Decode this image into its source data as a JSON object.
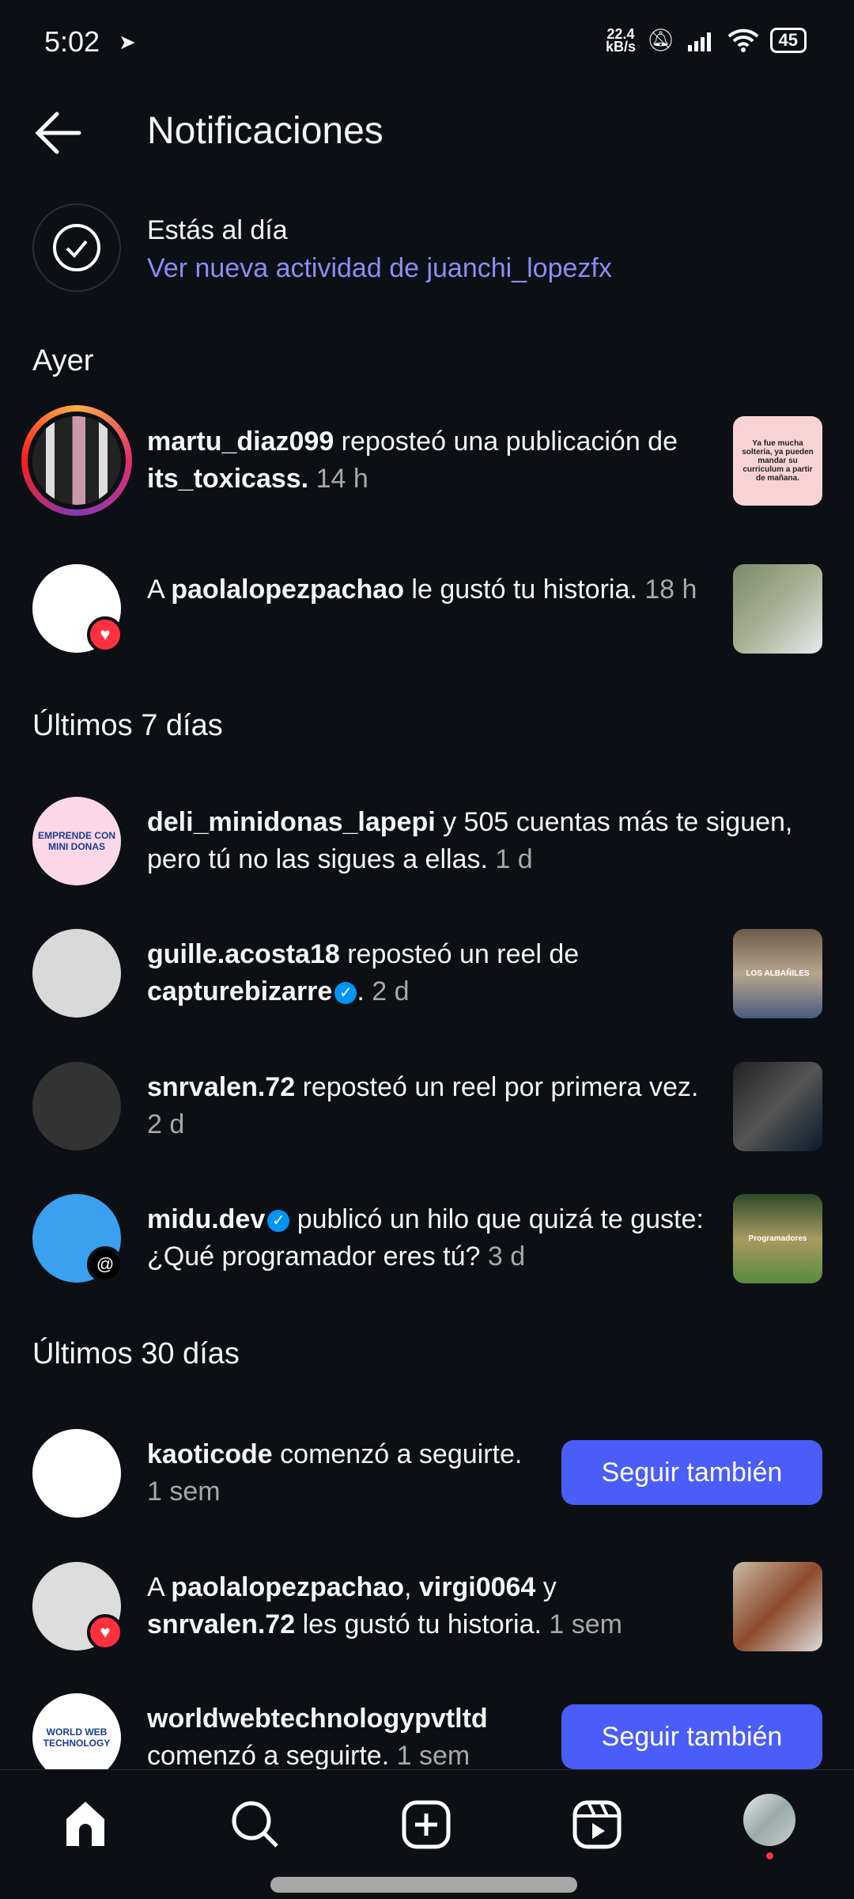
{
  "status_bar": {
    "time": "5:02",
    "net_speed": "22.4",
    "net_unit": "kB/s",
    "battery": "45"
  },
  "header": {
    "title": "Notificaciones"
  },
  "up_to_date": {
    "title": "Estás al día",
    "link": "Ver nueva actividad de juanchi_lopezfx"
  },
  "sections": [
    "Ayer",
    "Últimos 7 días",
    "Últimos 30 días"
  ],
  "notifications": [
    {
      "segments": [
        {
          "t": "martu_diaz099",
          "b": true
        },
        {
          "t": " reposteó una publicación de "
        },
        {
          "t": "its_toxicass.",
          "b": true
        },
        {
          "t": " 14 h",
          "m": true
        }
      ],
      "thumb": "Ya fue mucha soltería, ya pueden mandar su curriculum a partir de mañana.",
      "story_ring": true
    },
    {
      "segments": [
        {
          "t": "A "
        },
        {
          "t": "paolalopezpachao",
          "b": true
        },
        {
          "t": " le gustó tu historia."
        },
        {
          "t": " 18 h",
          "m": true
        }
      ],
      "badge": "heart-icon"
    },
    {
      "segments": [
        {
          "t": "deli_minidonas_lapepi",
          "b": true
        },
        {
          "t": " y 505 cuentas más te siguen, pero tú no las sigues a ellas."
        },
        {
          "t": " 1 d",
          "m": true
        }
      ],
      "avatar_text": "EMPRENDE CON MINI DONAS"
    },
    {
      "segments": [
        {
          "t": "guille.acosta18",
          "b": true
        },
        {
          "t": " reposteó un reel de "
        },
        {
          "t": "capturebizarre",
          "b": true,
          "verified": true
        },
        {
          "t": "."
        },
        {
          "t": " 2 d",
          "m": true
        }
      ],
      "thumb_text": "LOS ALBAÑILES"
    },
    {
      "segments": [
        {
          "t": "snrvalen.72",
          "b": true
        },
        {
          "t": " reposteó un reel por primera vez."
        },
        {
          "t": " 2 d",
          "m": true
        }
      ]
    },
    {
      "segments": [
        {
          "t": "midu.dev",
          "b": true,
          "verified": true
        },
        {
          "t": " publicó un hilo que quizá te guste: ¿Qué programador eres tú?"
        },
        {
          "t": " 3 d",
          "m": true
        }
      ],
      "badge": "threads-icon",
      "thumb_text": "Programadores"
    },
    {
      "segments": [
        {
          "t": "kaoticode",
          "b": true
        },
        {
          "t": " comenzó a seguirte."
        },
        {
          "t": " 1 sem",
          "m": true
        }
      ],
      "button": "Seguir también"
    },
    {
      "segments": [
        {
          "t": "A "
        },
        {
          "t": "paolalopezpachao",
          "b": true
        },
        {
          "t": ", "
        },
        {
          "t": "virgi0064",
          "b": true
        },
        {
          "t": " y "
        },
        {
          "t": "snrvalen.72",
          "b": true
        },
        {
          "t": " les gustó tu historia."
        },
        {
          "t": " 1 sem",
          "m": true
        }
      ],
      "badge": "heart-icon"
    },
    {
      "segments": [
        {
          "t": "worldwebtechnologypvtltd",
          "b": true
        },
        {
          "t": " comenzó a seguirte."
        },
        {
          "t": " 1 sem",
          "m": true
        }
      ],
      "button": "Seguir también",
      "avatar_text": "WORLD WEB TECHNOLOGY"
    }
  ],
  "bottom_nav": [
    "home-icon",
    "search-icon",
    "create-icon",
    "reels-icon",
    "profile-avatar"
  ],
  "colors": {
    "background": "#0c1014",
    "accent": "#4a5df9",
    "link": "#8c8cf5",
    "heart": "#ff3040"
  }
}
